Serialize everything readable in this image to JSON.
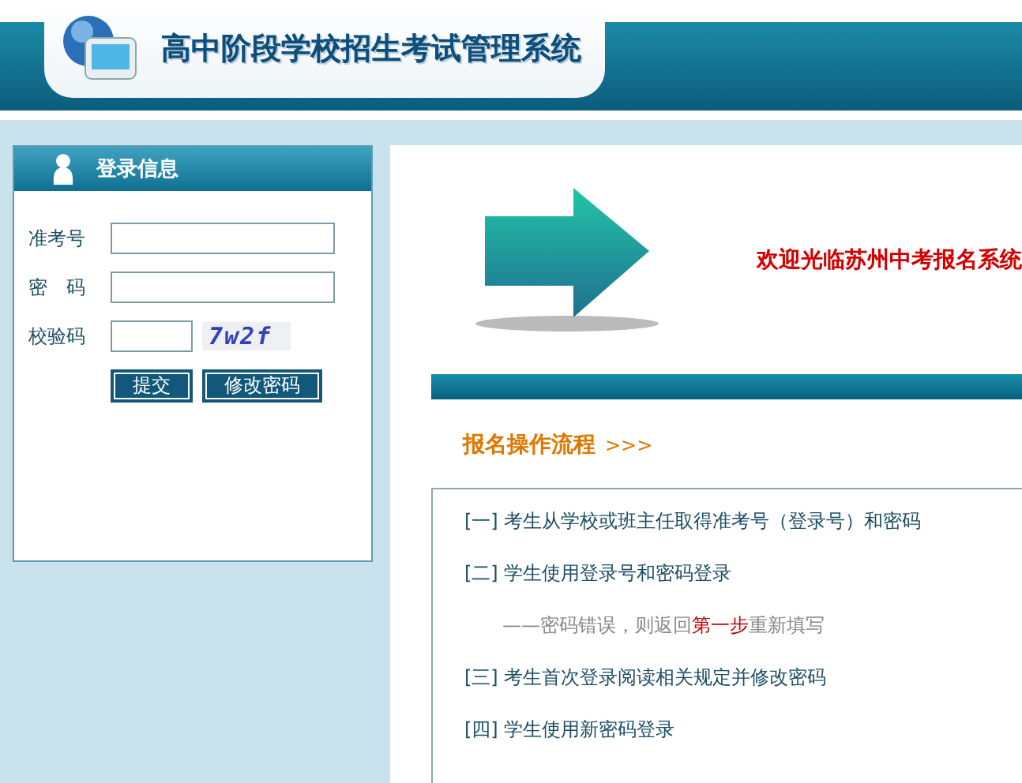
{
  "header": {
    "title": "高中阶段学校招生考试管理系统"
  },
  "login": {
    "title": "登录信息",
    "fields": [
      {
        "label": "准考号",
        "kind": "text"
      },
      {
        "label": "密　码",
        "kind": "password"
      },
      {
        "label": "校验码",
        "kind": "captcha",
        "captcha": "7w2f"
      }
    ],
    "buttons": [
      "提交",
      "修改密码"
    ]
  },
  "welcome": "欢迎光临苏州中考报名系统",
  "process": {
    "title": "报名操作流程",
    "arrows": ">>>",
    "steps": [
      {
        "kind": "step",
        "segments": [
          {
            "text": "[一] 考生从学校或班主任取得准考号（登录号）和密码",
            "highlight": false
          }
        ]
      },
      {
        "kind": "step",
        "segments": [
          {
            "text": "[二] 学生使用登录号和密码登录",
            "highlight": false
          }
        ]
      },
      {
        "kind": "note",
        "segments": [
          {
            "text": "——密码错误，则返回",
            "highlight": false
          },
          {
            "text": "第一步",
            "highlight": true
          },
          {
            "text": "重新填写",
            "highlight": false
          }
        ]
      },
      {
        "kind": "step",
        "segments": [
          {
            "text": "[三] 考生首次登录阅读相关规定并修改密码",
            "highlight": false
          }
        ]
      },
      {
        "kind": "step",
        "segments": [
          {
            "text": "[四] 学生使用新密码登录",
            "highlight": false
          }
        ]
      }
    ]
  }
}
